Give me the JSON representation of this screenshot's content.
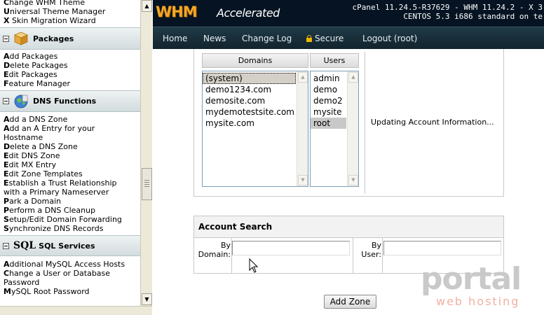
{
  "sidebar": {
    "theme_links": [
      {
        "first": "C",
        "rest": "hange WHM Theme"
      },
      {
        "first": "U",
        "rest": "niversal Theme Manager"
      },
      {
        "first": "X",
        "rest": " Skin Migration Wizard"
      }
    ],
    "packages": {
      "title": "Packages",
      "icon": "package-box-icon",
      "links": [
        {
          "first": "A",
          "rest": "dd Packages"
        },
        {
          "first": "D",
          "rest": "elete Packages"
        },
        {
          "first": "E",
          "rest": "dit Packages"
        },
        {
          "first": "F",
          "rest": "eature Manager"
        }
      ]
    },
    "dns": {
      "title": "DNS Functions",
      "icon": "globe-icon",
      "links": [
        {
          "first": "A",
          "rest": "dd a DNS Zone"
        },
        {
          "first": "A",
          "rest": "dd an A Entry for your"
        },
        {
          "first": "",
          "rest": "Hostname"
        },
        {
          "first": "D",
          "rest": "elete a DNS Zone"
        },
        {
          "first": "E",
          "rest": "dit DNS Zone"
        },
        {
          "first": "E",
          "rest": "dit MX Entry"
        },
        {
          "first": "E",
          "rest": "dit Zone Templates"
        },
        {
          "first": "E",
          "rest": "stablish a Trust Relationship"
        },
        {
          "first": "",
          "rest": "with a Primary Nameserver"
        },
        {
          "first": "P",
          "rest": "ark a Domain"
        },
        {
          "first": "P",
          "rest": "erform a DNS Cleanup"
        },
        {
          "first": "S",
          "rest": "etup/Edit Domain Forwarding"
        },
        {
          "first": "S",
          "rest": "ynchronize DNS Records"
        }
      ]
    },
    "sql": {
      "title": "SQL Services",
      "icon_text": "SQL",
      "links": [
        {
          "first": "A",
          "rest": "dditional MySQL Access Hosts"
        },
        {
          "first": "C",
          "rest": "hange a User or Database"
        },
        {
          "first": "",
          "rest": "Password"
        },
        {
          "first": "M",
          "rest": "ySQL Root Password"
        }
      ]
    }
  },
  "header": {
    "logo_main": "WHM",
    "logo_sub": "Accelerated",
    "version_line1": "cPanel 11.24.5-R37629 - WHM 11.24.2 - X 3",
    "version_line2": "CENTOS 5.3 i686 standard on te"
  },
  "nav": {
    "home": "Home",
    "news": "News",
    "changelog": "Change Log",
    "secure": "Secure",
    "logout": "Logout (root)"
  },
  "zone_panel": {
    "domains_header": "Domains",
    "users_header": "Users",
    "domains": [
      "(system)",
      "demo1234.com",
      "demosite.com",
      "mydemotestsite.com",
      "mysite.com"
    ],
    "users": [
      "admin",
      "demo",
      "demo2",
      "mysite",
      "root"
    ],
    "status": "Updating Account Information..."
  },
  "account_search": {
    "title": "Account Search",
    "by_domain_line1": "By",
    "by_domain_line2": "Domain:",
    "by_user_line1": "By",
    "by_user_line2": "User:",
    "domain_value": "",
    "user_value": ""
  },
  "add_zone_label": "Add Zone",
  "watermark": {
    "main": "portal",
    "sub": "web hosting"
  },
  "colors": {
    "topbar": "#051322",
    "logo_orange": "#f5a623",
    "nav_bg": "#1a3340"
  }
}
